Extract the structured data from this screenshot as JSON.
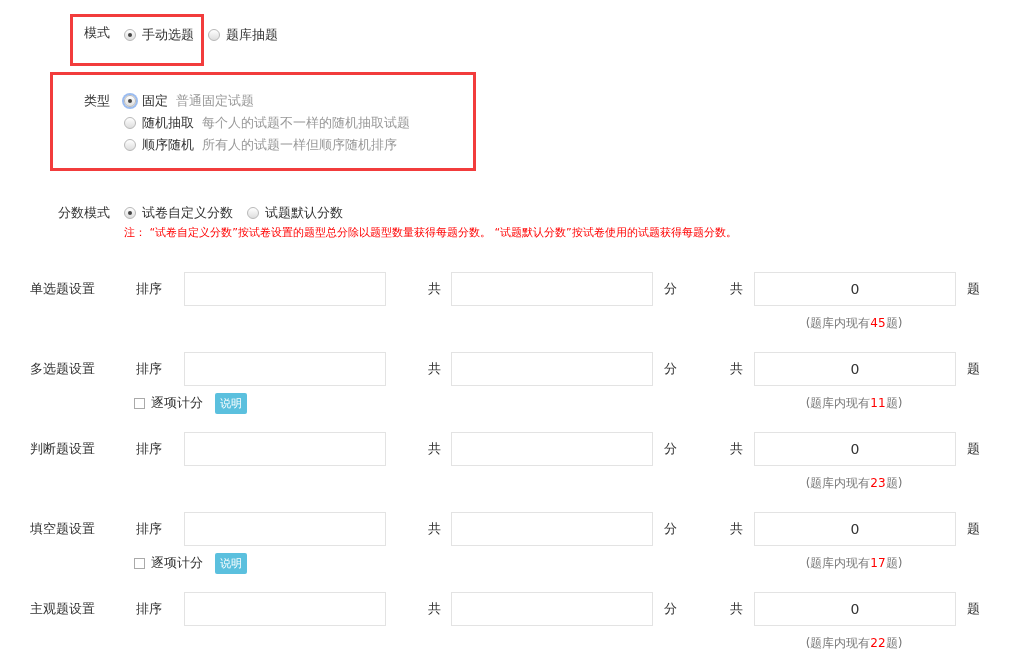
{
  "mode": {
    "label": "模式",
    "options": [
      {
        "label": "手动选题",
        "selected": true
      },
      {
        "label": "题库抽题",
        "selected": false
      }
    ]
  },
  "type": {
    "label": "类型",
    "options": [
      {
        "label": "固定",
        "hint": "普通固定试题",
        "selected": true
      },
      {
        "label": "随机抽取",
        "hint": "每个人的试题不一样的随机抽取试题",
        "selected": false
      },
      {
        "label": "顺序随机",
        "hint": "所有人的试题一样但顺序随机排序",
        "selected": false
      }
    ]
  },
  "score_mode": {
    "label": "分数模式",
    "options": [
      {
        "label": "试卷自定义分数",
        "selected": true
      },
      {
        "label": "试题默认分数",
        "selected": false
      }
    ],
    "note": "注：  “试卷自定义分数”按试卷设置的题型总分除以题型数量获得每题分数。  “试题默认分数”按试卷使用的试题获得每题分数。"
  },
  "question_settings": [
    {
      "label": "单选题设置",
      "order_label": "排序",
      "total_label": "共",
      "score_unit": "分",
      "count_label": "共",
      "count_value": "0",
      "count_unit": "题",
      "bank_prefix": "(题库内现有",
      "bank_count": "45",
      "bank_suffix": "题)"
    },
    {
      "label": "多选题设置",
      "order_label": "排序",
      "total_label": "共",
      "score_unit": "分",
      "count_label": "共",
      "count_value": "0",
      "count_unit": "题",
      "bank_prefix": "(题库内现有",
      "bank_count": "11",
      "bank_suffix": "题)",
      "per_item": {
        "label": "逐项计分",
        "checked": false,
        "help": "说明"
      }
    },
    {
      "label": "判断题设置",
      "order_label": "排序",
      "total_label": "共",
      "score_unit": "分",
      "count_label": "共",
      "count_value": "0",
      "count_unit": "题",
      "bank_prefix": "(题库内现有",
      "bank_count": "23",
      "bank_suffix": "题)"
    },
    {
      "label": "填空题设置",
      "order_label": "排序",
      "total_label": "共",
      "score_unit": "分",
      "count_label": "共",
      "count_value": "0",
      "count_unit": "题",
      "bank_prefix": "(题库内现有",
      "bank_count": "17",
      "bank_suffix": "题)",
      "per_item": {
        "label": "逐项计分",
        "checked": false,
        "help": "说明"
      }
    },
    {
      "label": "主观题设置",
      "order_label": "排序",
      "total_label": "共",
      "score_unit": "分",
      "count_label": "共",
      "count_value": "0",
      "count_unit": "题",
      "bank_prefix": "(题库内现有",
      "bank_count": "22",
      "bank_suffix": "题)"
    }
  ]
}
